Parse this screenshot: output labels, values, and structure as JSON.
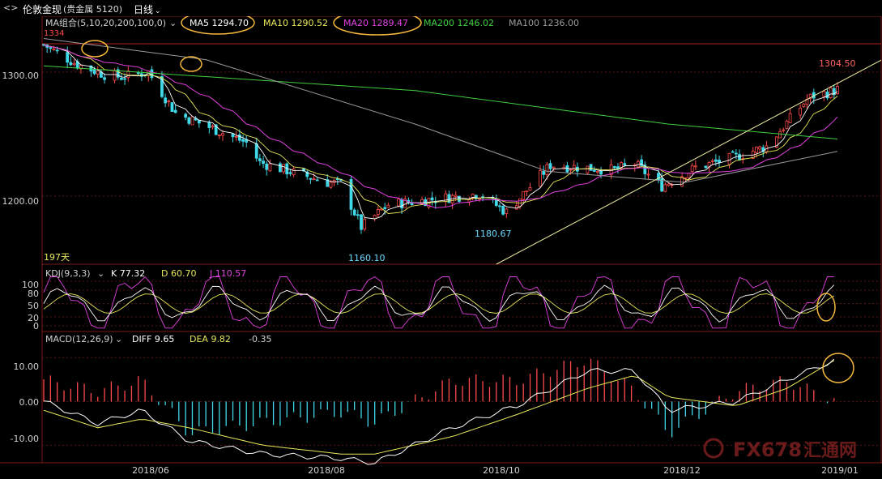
{
  "header": {
    "back_icon": "back-arrow-icon",
    "symbol": "伦敦金现",
    "market": "(贵金属 5120)",
    "period": "日线",
    "caret": "⌄"
  },
  "ma_legend": {
    "group": "MA组合(5,10,20,200,100,0)",
    "ma5": "MA5 1294.70",
    "ma10": "MA10 1290.52",
    "ma20": "MA20 1289.47",
    "ma200": "MA200 1246.02",
    "ma100": "MA100 1236.00",
    "corner_value": "1334"
  },
  "colors": {
    "up": "#ff4a4a",
    "down": "#3fd9e8",
    "ma5": "#ffffff",
    "ma10": "#e8e85a",
    "ma20": "#e040e0",
    "ma200": "#40d040",
    "ma100": "#9a9a9a",
    "highlight": "#f4b63c",
    "trend": "#f0f0a0"
  },
  "price_axis": {
    "ticks": [
      "1300.00",
      "1200.00"
    ]
  },
  "kdj_legend": {
    "label": "KDJ(9,3,3)",
    "k": "K 77.32",
    "d": "D 60.70",
    "j": "J 110.57"
  },
  "kdj_axis": {
    "ticks": [
      "100",
      "80",
      "50",
      "20",
      "0"
    ]
  },
  "macd_legend": {
    "label": "MACD(12,26,9)",
    "diff": "DIFF 9.65",
    "dea": "DEA 9.82",
    "macd": "-0.35"
  },
  "macd_axis": {
    "ticks": [
      "10.00",
      "0.00",
      "-10.00"
    ]
  },
  "time_axis": {
    "labels": [
      "2018/06",
      "2018/08",
      "2018/10",
      "2018/12",
      "2019/01"
    ]
  },
  "annotations": {
    "days": "197天",
    "high": "1304.50",
    "low1": "1160.10",
    "low2": "1180.67"
  },
  "watermark": {
    "text": "FX678",
    "cn": "汇通网"
  },
  "chart_data": {
    "type": "candlestick",
    "x_range": [
      "2018-05-14",
      "2019-01-04"
    ],
    "ylim": [
      1145,
      1345
    ],
    "y_ticks": [
      1200,
      1300
    ],
    "anchors": [
      [
        "2018-05-14",
        1322
      ],
      [
        "2018-05-24",
        1306
      ],
      [
        "2018-06-01",
        1298
      ],
      [
        "2018-06-06",
        1296
      ],
      [
        "2018-06-14",
        1300
      ],
      [
        "2018-06-22",
        1267
      ],
      [
        "2018-07-13",
        1243
      ],
      [
        "2018-07-17",
        1227
      ],
      [
        "2018-08-06",
        1211
      ],
      [
        "2018-08-10",
        1210
      ],
      [
        "2018-08-16",
        1175
      ],
      [
        "2018-08-24",
        1193
      ],
      [
        "2018-09-11",
        1199
      ],
      [
        "2018-09-20",
        1202
      ],
      [
        "2018-09-28",
        1187
      ],
      [
        "2018-10-11",
        1225
      ],
      [
        "2018-10-30",
        1221
      ],
      [
        "2018-11-05",
        1226
      ],
      [
        "2018-11-13",
        1208
      ],
      [
        "2018-11-23",
        1223
      ],
      [
        "2018-12-03",
        1230
      ],
      [
        "2018-12-14",
        1240
      ],
      [
        "2018-12-26",
        1278
      ],
      [
        "2018-12-28",
        1281
      ],
      [
        "2019-01-02",
        1284
      ],
      [
        "2019-01-04",
        1286
      ]
    ],
    "extremes": {
      "high": 1304.5,
      "low1": 1160.1,
      "low2": 1180.67
    },
    "ma": {
      "ma5": 1294.7,
      "ma10": 1290.52,
      "ma20": 1289.47,
      "ma200": [
        [
          "2018-05-14",
          1305
        ],
        [
          "2018-09-01",
          1285
        ],
        [
          "2018-11-15",
          1258
        ],
        [
          "2019-01-04",
          1246
        ]
      ],
      "ma100": [
        [
          "2018-05-14",
          1327
        ],
        [
          "2018-07-01",
          1310
        ],
        [
          "2018-09-01",
          1258
        ],
        [
          "2018-10-10",
          1220
        ],
        [
          "2018-11-20",
          1211
        ],
        [
          "2019-01-04",
          1236
        ]
      ]
    },
    "trendline": [
      [
        "2018-09-25",
        1130
      ],
      [
        "2019-01-04",
        1290
      ]
    ],
    "kdj": {
      "k": 77.32,
      "d": 60.7,
      "j": 110.57,
      "ylim": [
        0,
        100
      ]
    },
    "macd": {
      "ylim": [
        -14,
        16
      ],
      "diff": [
        [
          "2018-05-14",
          0
        ],
        [
          "2018-05-30",
          -5
        ],
        [
          "2018-06-12",
          -2
        ],
        [
          "2018-06-26",
          -9
        ],
        [
          "2018-07-18",
          -12
        ],
        [
          "2018-08-10",
          -13
        ],
        [
          "2018-08-20",
          -14
        ],
        [
          "2018-09-12",
          -6
        ],
        [
          "2018-10-01",
          -1
        ],
        [
          "2018-10-22",
          7
        ],
        [
          "2018-11-05",
          7
        ],
        [
          "2018-11-15",
          -2
        ],
        [
          "2018-12-05",
          0
        ],
        [
          "2018-12-20",
          5
        ],
        [
          "2019-01-04",
          9.65
        ]
      ],
      "dea": [
        [
          "2018-05-14",
          -2
        ],
        [
          "2018-05-30",
          -6
        ],
        [
          "2018-06-12",
          -4
        ],
        [
          "2018-06-26",
          -6
        ],
        [
          "2018-07-18",
          -10
        ],
        [
          "2018-08-10",
          -12
        ],
        [
          "2018-08-20",
          -12
        ],
        [
          "2018-09-12",
          -8
        ],
        [
          "2018-10-01",
          -3
        ],
        [
          "2018-10-22",
          3
        ],
        [
          "2018-11-05",
          6
        ],
        [
          "2018-11-15",
          1
        ],
        [
          "2018-12-05",
          -1
        ],
        [
          "2018-12-20",
          3
        ],
        [
          "2019-01-04",
          9.82
        ]
      ]
    }
  }
}
